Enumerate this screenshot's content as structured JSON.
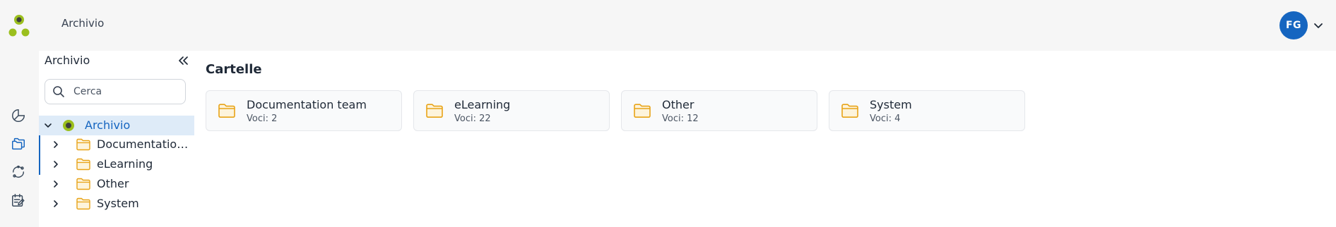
{
  "header": {
    "breadcrumb": "Archivio",
    "user_initials": "FG",
    "logo_colors": {
      "top": "#3f3f3f",
      "ring": "#9bbf1e"
    },
    "avatar_color": "#1565c0"
  },
  "rail": {
    "items": [
      {
        "icon": "pie-chart-icon"
      },
      {
        "icon": "folders-icon",
        "active": true
      },
      {
        "icon": "sync-icon"
      },
      {
        "icon": "task-edit-icon"
      }
    ]
  },
  "tree": {
    "title": "Archivio",
    "search": {
      "placeholder": "Cerca",
      "value": ""
    },
    "root": {
      "label": "Archivio",
      "expanded": true
    },
    "children": [
      {
        "label": "Documentation team"
      },
      {
        "label": "eLearning"
      },
      {
        "label": "Other"
      },
      {
        "label": "System"
      }
    ]
  },
  "main": {
    "section_title": "Cartelle",
    "folders": [
      {
        "name": "Documentation team",
        "count": "Voci: 2"
      },
      {
        "name": "eLearning",
        "count": "Voci: 22"
      },
      {
        "name": "Other",
        "count": "Voci: 12"
      },
      {
        "name": "System",
        "count": "Voci: 4"
      }
    ],
    "folder_color": "#e8a317"
  }
}
